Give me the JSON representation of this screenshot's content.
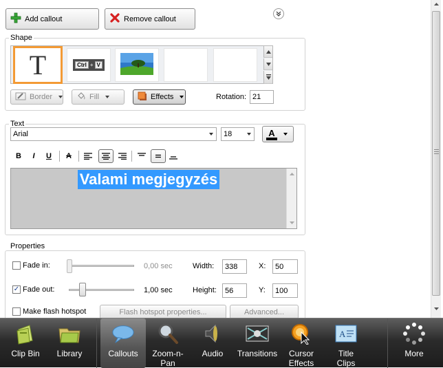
{
  "toolbar": {
    "add_callout": "Add callout",
    "remove_callout": "Remove callout"
  },
  "shape": {
    "legend": "Shape",
    "border_label": "Border",
    "fill_label": "Fill",
    "effects_label": "Effects",
    "rotation_label": "Rotation:",
    "rotation_value": "21"
  },
  "text": {
    "legend": "Text",
    "font": "Arial",
    "size": "18",
    "font_color_glyph": "A",
    "content": "Valami megjegyzés",
    "bold": "B",
    "italic": "I",
    "underline": "U",
    "strike": "A"
  },
  "properties": {
    "legend": "Properties",
    "fade_in_label": "Fade in:",
    "fade_in_checked": false,
    "fade_in_value": "0,00 sec",
    "fade_out_label": "Fade out:",
    "fade_out_checked": true,
    "fade_out_value": "1,00 sec",
    "width_label": "Width:",
    "width_value": "338",
    "height_label": "Height:",
    "height_value": "56",
    "x_label": "X:",
    "x_value": "50",
    "y_label": "Y:",
    "y_value": "100",
    "flash_label": "Make flash hotspot",
    "flash_checked": false,
    "flash_props_button": "Flash hotspot properties...",
    "advanced_button": "Advanced..."
  },
  "taskbar": {
    "items": [
      {
        "label": "Clip Bin",
        "icon": "clip-bin-icon"
      },
      {
        "label": "Library",
        "icon": "library-icon"
      },
      {
        "label": "Callouts",
        "icon": "callouts-icon",
        "active": true
      },
      {
        "label": "Zoom-n-\nPan",
        "icon": "magnifier-icon"
      },
      {
        "label": "Audio",
        "icon": "speaker-icon"
      },
      {
        "label": "Transitions",
        "icon": "transitions-icon"
      },
      {
        "label": "Cursor\nEffects",
        "icon": "cursor-effects-icon"
      },
      {
        "label": "Title\nClips",
        "icon": "title-clips-icon"
      },
      {
        "label": "More",
        "icon": "more-icon"
      }
    ]
  },
  "colors": {
    "selection": "#3399ff",
    "thumb_highlight": "#f39a34",
    "editor_bg": "#c8c8c8"
  }
}
